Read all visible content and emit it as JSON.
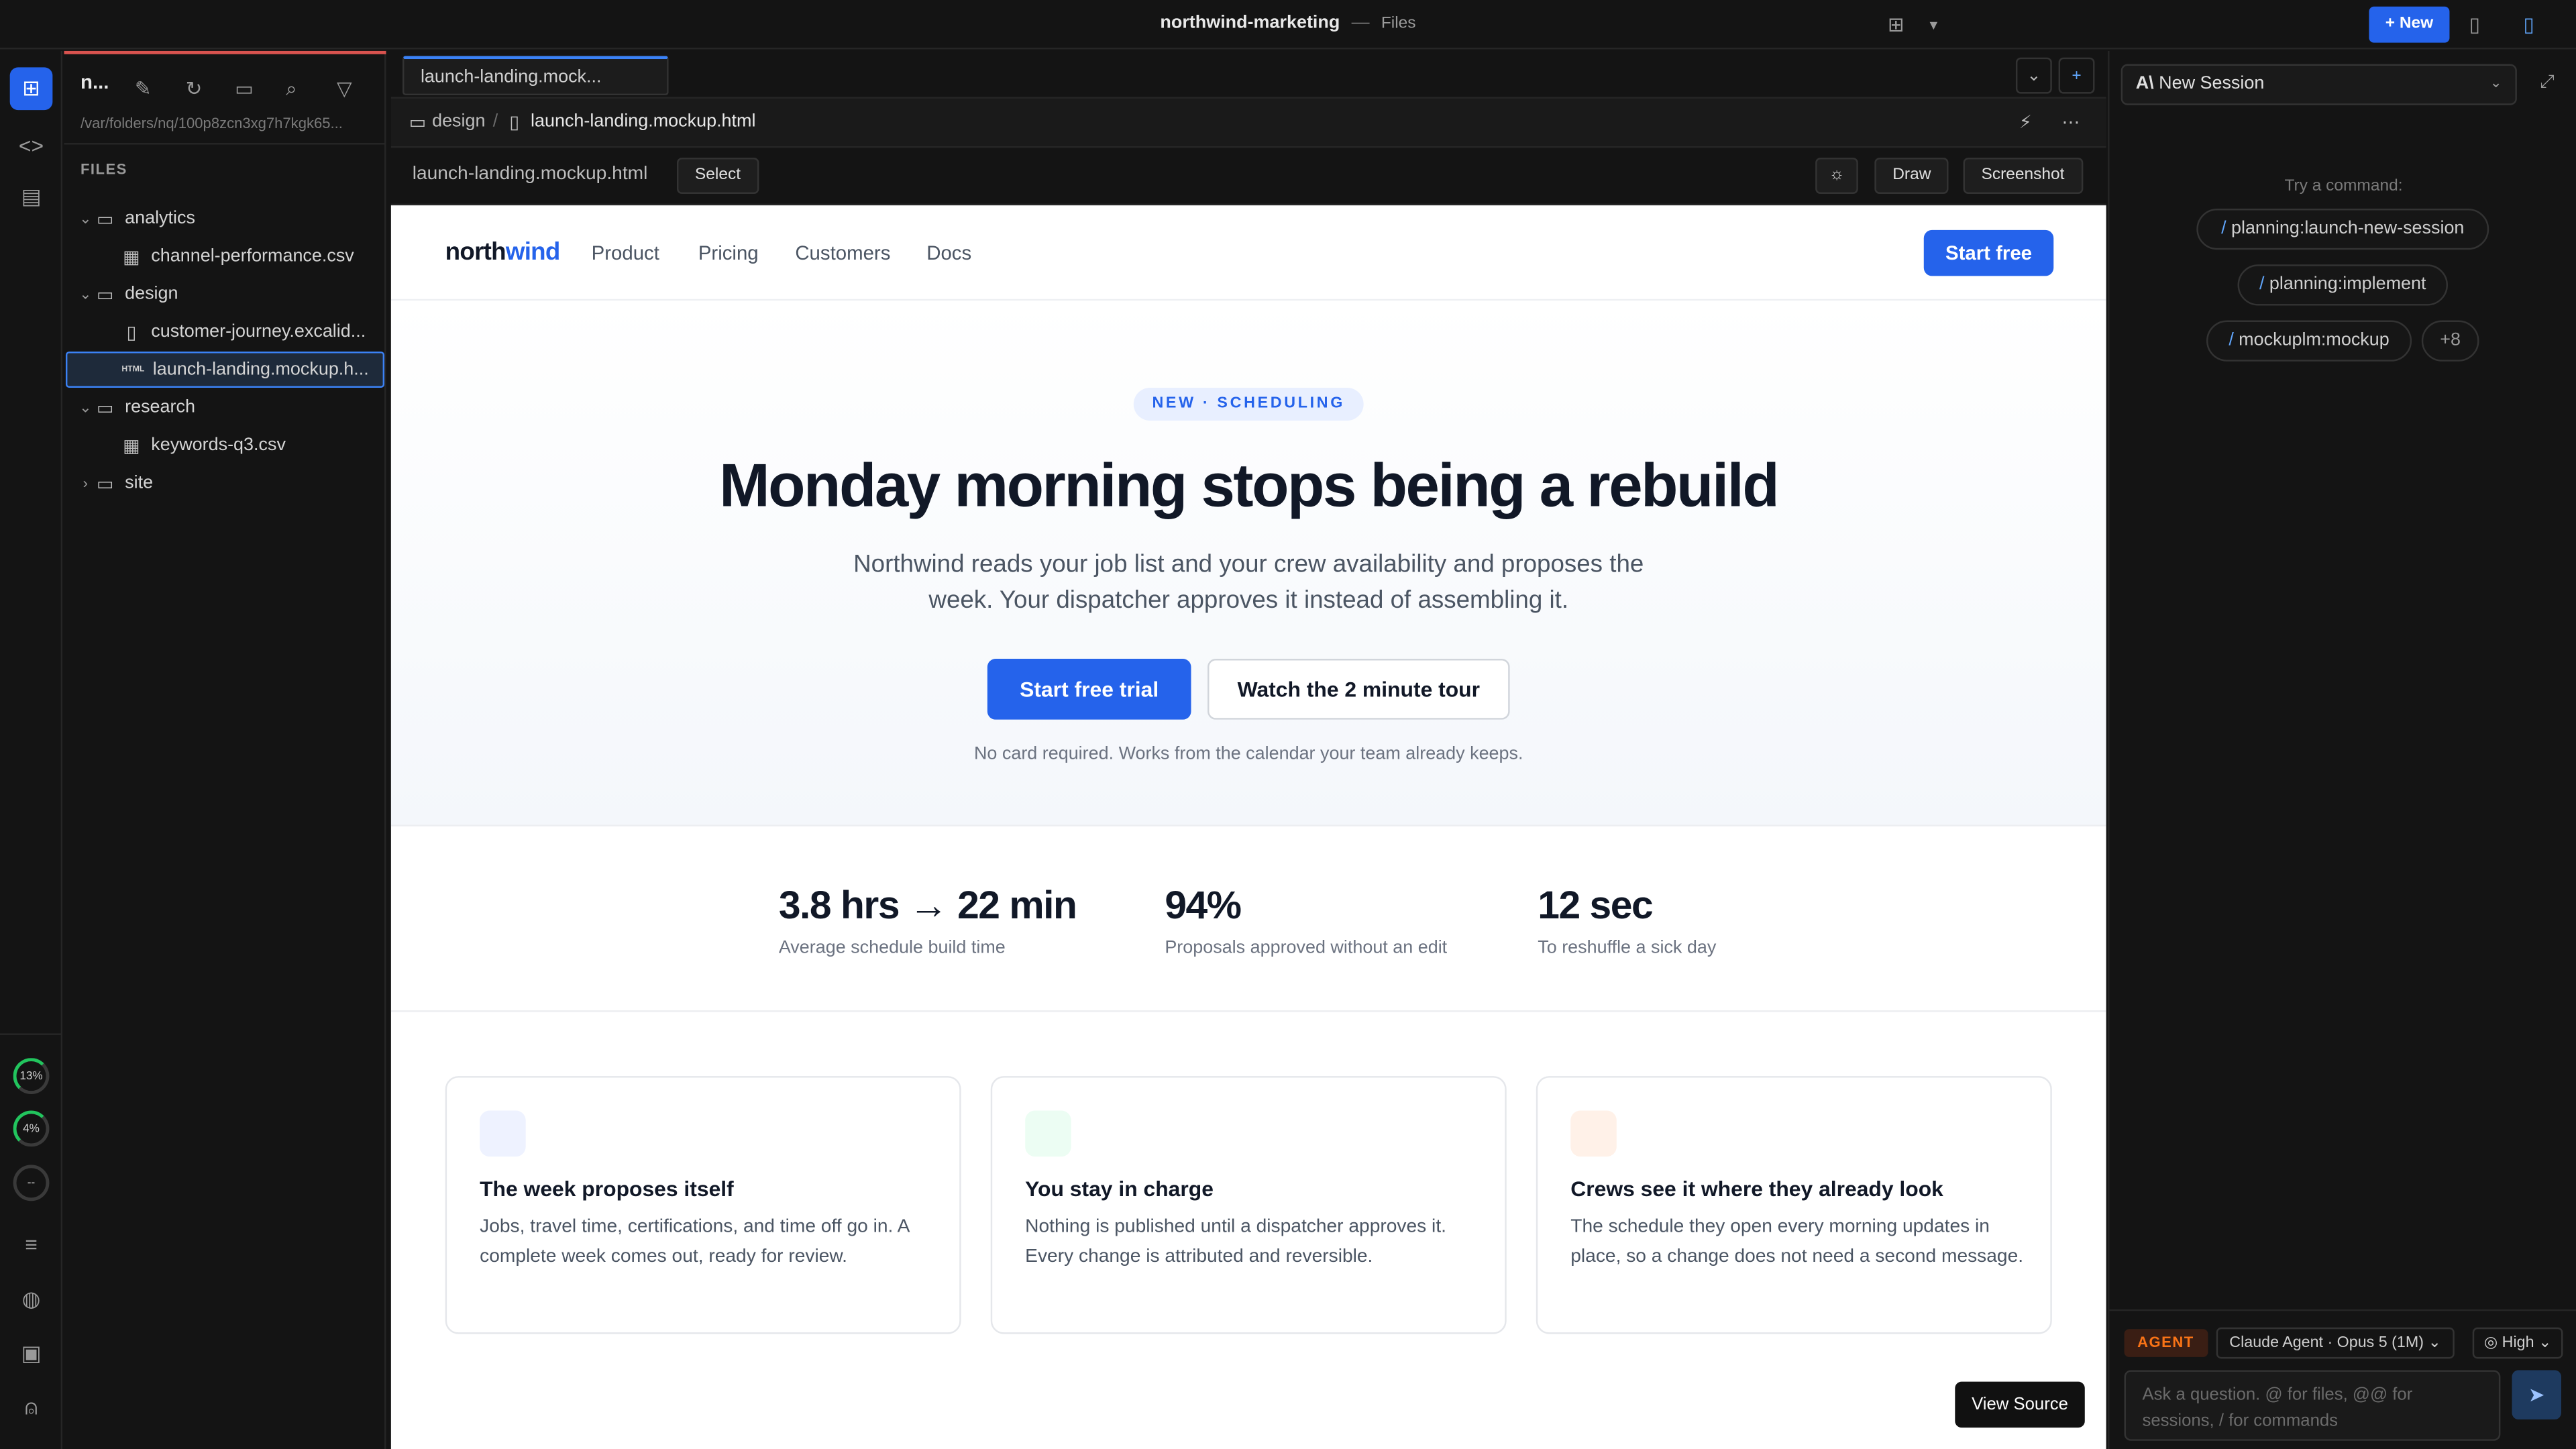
{
  "window": {
    "project": "northwind-marketing",
    "separator": "—",
    "mode": "Files",
    "new_label": "New"
  },
  "rail": {
    "usage": [
      "13%",
      "4%",
      "--"
    ]
  },
  "files": {
    "project_short": "n...",
    "path": "/var/folders/nq/100p8zcn3xg7h7kgk65...",
    "section_label": "FILES",
    "tree": [
      {
        "name": "analytics",
        "type": "folder",
        "open": true
      },
      {
        "name": "channel-performance.csv",
        "type": "table"
      },
      {
        "name": "design",
        "type": "folder",
        "open": true
      },
      {
        "name": "customer-journey.excalid...",
        "type": "file"
      },
      {
        "name": "launch-landing.mockup.h...",
        "type": "html",
        "icon_label": "HTML"
      },
      {
        "name": "research",
        "type": "folder",
        "open": true
      },
      {
        "name": "keywords-q3.csv",
        "type": "table"
      },
      {
        "name": "site",
        "type": "folder",
        "open": false
      }
    ]
  },
  "editor": {
    "tab_label": "launch-landing.mock...",
    "breadcrumb": {
      "folder": "design",
      "slash": "/",
      "file": "launch-landing.mockup.html"
    },
    "file_name": "launch-landing.mockup.html",
    "select_label": "Select",
    "draw_label": "Draw",
    "screenshot_label": "Screenshot"
  },
  "preview": {
    "logo_main": "north",
    "logo_accent": "wind",
    "nav": [
      "Product",
      "Pricing",
      "Customers",
      "Docs"
    ],
    "start_free": "Start free",
    "badge": "NEW · SCHEDULING",
    "headline": "Monday morning stops being a rebuild",
    "subhead": "Northwind reads your job list and your crew availability and proposes the week. Your dispatcher approves it instead of assembling it.",
    "cta_primary": "Start free trial",
    "cta_secondary": "Watch the 2 minute tour",
    "note": "No card required. Works from the calendar your team already keeps.",
    "stats": [
      {
        "value": "3.8 hrs → 22 min",
        "label": "Average schedule build time"
      },
      {
        "value": "94%",
        "label": "Proposals approved without an edit"
      },
      {
        "value": "12 sec",
        "label": "To reshuffle a sick day"
      }
    ],
    "cards": [
      {
        "title": "The week proposes itself",
        "desc": "Jobs, travel time, certifications, and time off go in. A complete week comes out, ready for review.",
        "color": "#eef2ff"
      },
      {
        "title": "You stay in charge",
        "desc": "Nothing is published until a dispatcher approves it. Every change is attributed and reversible.",
        "color": "#ecfdf3"
      },
      {
        "title": "Crews see it where they already look",
        "desc": "The schedule they open every morning updates in place, so a change does not need a second message.",
        "color": "#fff1e8"
      }
    ],
    "view_source": "View Source"
  },
  "agent": {
    "session_label": "New Session",
    "try_label": "Try a command:",
    "commands": [
      "planning:launch-new-session",
      "planning:implement",
      "mockuplm:mockup"
    ],
    "more": "+8",
    "badge": "AGENT",
    "model": "Claude Agent · Opus 5 (1M)",
    "effort": "High",
    "placeholder": "Ask a question. @ for files, @@ for sessions, / for commands"
  },
  "colors": {
    "accent": "#2563eb",
    "top_accent": "#d9534f",
    "agent_badge": "#f97316"
  }
}
